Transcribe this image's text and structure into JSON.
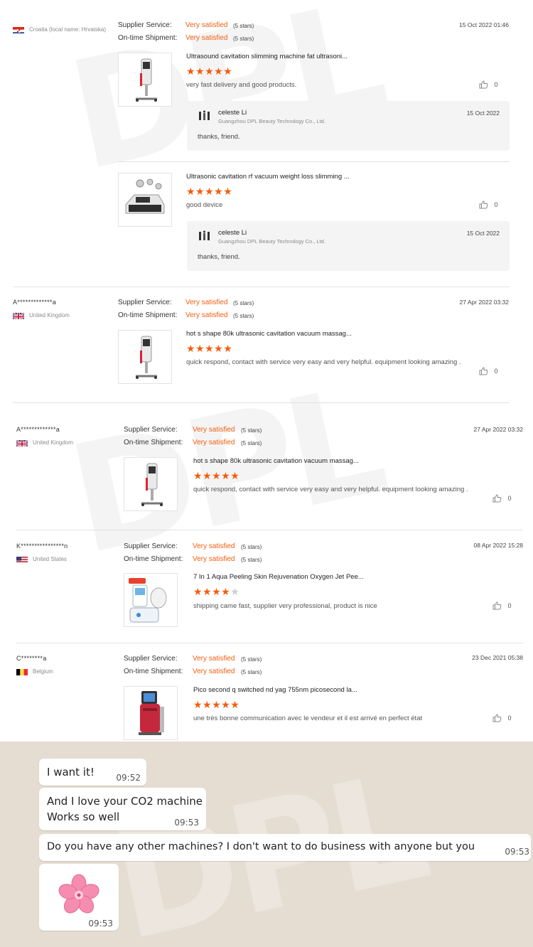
{
  "reviews": [
    {
      "name": "",
      "country": "Croatia (local name: Hrvatska)",
      "flag": "croatia-flag-icon",
      "supplier_label": "Supplier Service:",
      "supplier_value": "Very satisfied",
      "supplier_stars": "(5 stars)",
      "shipment_label": "On-time Shipment:",
      "shipment_value": "Very satisfied",
      "shipment_stars": "(5 stars)",
      "date": "15 Oct 2022 01:46",
      "products": [
        {
          "title": "Ultrasound cavitation slimming machine fat ultrasoni...",
          "rating": 5,
          "comment": "very fast delivery and good products.",
          "likes": "0",
          "reply": {
            "name": "celeste Li",
            "company": "Guangzhou DPL Beauty Technology Co., Ltd.",
            "date": "15 Oct 2022",
            "text": "thanks, friend."
          }
        },
        {
          "title": "Ultrasonic cavitation rf vacuum weight loss slimming ...",
          "rating": 5,
          "comment": "good device",
          "likes": "0",
          "reply": {
            "name": "celeste Li",
            "company": "Guangzhou DPL Beauty Technology Co., Ltd.",
            "date": "15 Oct 2022",
            "text": "thanks, friend."
          }
        }
      ]
    },
    {
      "name": "A*************a",
      "country": "United Kingdom",
      "flag": "uk-flag-icon",
      "supplier_label": "Supplier Service:",
      "supplier_value": "Very satisfied",
      "supplier_stars": "(5 stars)",
      "shipment_label": "On-time Shipment:",
      "shipment_value": "Very satisfied",
      "shipment_stars": "(5 stars)",
      "date": "27 Apr 2022 03:32",
      "products": [
        {
          "title": "hot s shape 80k ultrasonic cavitation vacuum massag...",
          "rating": 5,
          "comment": "quick respond, contact with service very easy and very helpful. equipment looking amazing .",
          "likes": "0"
        }
      ]
    },
    {
      "name": "A*************a",
      "country": "United Kingdom",
      "flag": "uk-flag-icon",
      "supplier_label": "Supplier Service:",
      "supplier_value": "Very satisfied",
      "supplier_stars": "(5 stars)",
      "shipment_label": "On-time Shipment:",
      "shipment_value": "Very satisfied",
      "shipment_stars": "(5 stars)",
      "date": "27 Apr 2022 03:32",
      "products": [
        {
          "title": "hot s shape 80k ultrasonic cavitation vacuum massag...",
          "rating": 5,
          "comment": "quick respond, contact with service very easy and very helpful. equipment looking amazing .",
          "likes": "0"
        }
      ]
    },
    {
      "name": "K****************n",
      "country": "United States",
      "flag": "us-flag-icon",
      "supplier_label": "Supplier Service:",
      "supplier_value": "Very satisfied",
      "supplier_stars": "(5 stars)",
      "shipment_label": "On-time Shipment:",
      "shipment_value": "Very satisfied",
      "shipment_stars": "(5 stars)",
      "date": "08 Apr 2022 15:28",
      "products": [
        {
          "title": "7 In 1 Aqua Peeling Skin Rejuvenation Oxygen Jet Pee...",
          "rating": 4,
          "comment": "shipping came fast, supplier very professional, product is nice",
          "likes": "0"
        }
      ]
    },
    {
      "name": "C********a",
      "country": "Belgium",
      "flag": "belgium-flag-icon",
      "supplier_label": "Supplier Service:",
      "supplier_value": "Very satisfied",
      "supplier_stars": "(5 stars)",
      "shipment_label": "On-time Shipment:",
      "shipment_value": "Very satisfied",
      "shipment_stars": "(5 stars)",
      "date": "23 Dec 2021 05:38",
      "products": [
        {
          "title": "Pico second q switched nd yag 755nm picosecond la...",
          "rating": 5,
          "comment": "une très bonne communication avec le vendeur et il est arrivé en perfect état",
          "likes": "0"
        }
      ]
    }
  ],
  "chat": {
    "messages": [
      {
        "lines": [
          "I want it!"
        ],
        "time": "09:52"
      },
      {
        "lines": [
          "And I love your CO2 machine",
          "Works so well"
        ],
        "time": "09:53"
      },
      {
        "lines": [
          "Do you have any other machines? I don't want to do business with anyone but you"
        ],
        "time": "09:53"
      },
      {
        "sticker": "cherry-blossom-sticker-icon",
        "time": "09:53"
      }
    ]
  },
  "colors": {
    "accent": "#f25d0e",
    "star_off": "#cfcfcf",
    "chat_bg": "#e5ddd2"
  }
}
